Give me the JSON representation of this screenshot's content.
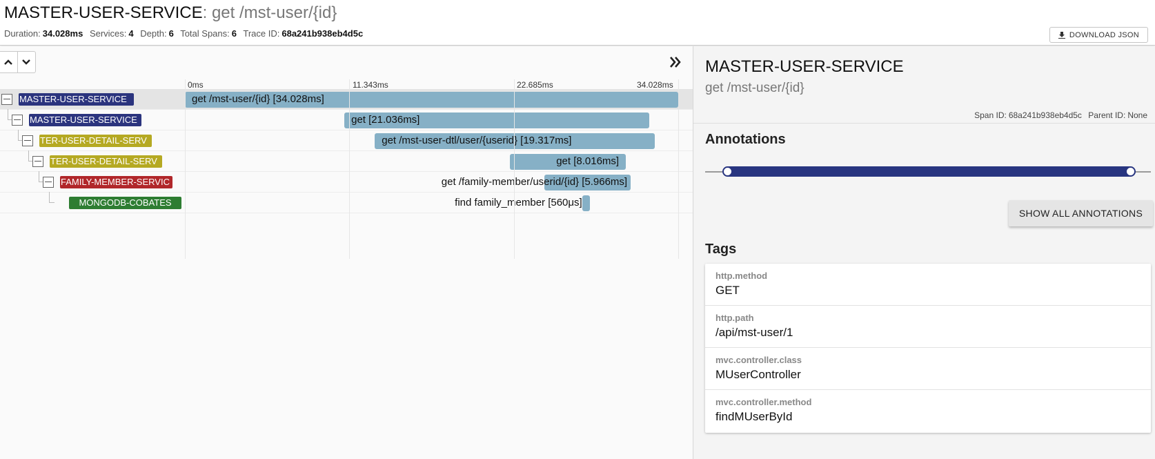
{
  "header": {
    "service": "MASTER-USER-SERVICE",
    "separator": ":",
    "span_name": " get /mst-user/{id}",
    "summary": [
      {
        "label": "Duration:",
        "value": "34.028ms"
      },
      {
        "label": "Services:",
        "value": "4"
      },
      {
        "label": "Depth:",
        "value": "6"
      },
      {
        "label": "Total Spans:",
        "value": "6"
      },
      {
        "label": "Trace ID:",
        "value": "68a241b938eb4d5c"
      }
    ],
    "download_label": "DOWNLOAD JSON"
  },
  "timeline": {
    "ticks": [
      "0ms",
      "11.343ms",
      "22.685ms",
      "34.028ms"
    ],
    "total_ms": 34.028,
    "spans": [
      {
        "service": "MASTER-USER-SERVICE",
        "service_display": "MASTER-USER-SERVICE",
        "depth": 0,
        "color": "#2b347e",
        "text_color": "#ffffff",
        "name": "get /mst-user/{id} [34.028ms]",
        "start_ms": 0.0,
        "duration_ms": 34.028,
        "selected": true
      },
      {
        "service": "MASTER-USER-SERVICE",
        "service_display": "MASTER-USER-SERVICE",
        "depth": 1,
        "color": "#2b347e",
        "text_color": "#ffffff",
        "name": "get [21.036ms]",
        "start_ms": 11.0,
        "duration_ms": 21.036,
        "selected": false
      },
      {
        "service": "MASTER-USER-DETAIL-SERVICE",
        "service_display": "TER-USER-DETAIL-SERV",
        "depth": 2,
        "color": "#b5a922",
        "text_color": "#ffffff",
        "name": "get /mst-user-dtl/user/{userid} [19.317ms]",
        "start_ms": 13.1,
        "duration_ms": 19.317,
        "selected": false
      },
      {
        "service": "MASTER-USER-DETAIL-SERVICE",
        "service_display": "TER-USER-DETAIL-SERV",
        "depth": 3,
        "color": "#b5a922",
        "text_color": "#ffffff",
        "name": "get [8.016ms]",
        "start_ms": 22.4,
        "duration_ms": 8.016,
        "selected": false
      },
      {
        "service": "FAMILY-MEMBER-SERVICE",
        "service_display": "FAMILY-MEMBER-SERVIC",
        "depth": 4,
        "color": "#b1272a",
        "text_color": "#ffffff",
        "name": "get /family-member/userid/{id} [5.966ms]",
        "start_ms": 24.8,
        "duration_ms": 5.966,
        "selected": false
      },
      {
        "service": "MONGODB-COBATES",
        "service_display": "MONGODB-COBATES",
        "depth": 5,
        "color": "#2e7d32",
        "text_color": "#ffffff",
        "name": "find family_member [560μs]",
        "start_ms": 27.4,
        "duration_ms": 0.56,
        "selected": false
      }
    ]
  },
  "detail": {
    "service": "MASTER-USER-SERVICE",
    "span_name": "get /mst-user/{id}",
    "span_id_label": "Span ID:",
    "span_id": "68a241b938eb4d5c",
    "parent_id_label": "Parent ID:",
    "parent_id": "None",
    "annotations_title": "Annotations",
    "show_all_label": "SHOW ALL ANNOTATIONS",
    "tags_title": "Tags",
    "tags": [
      {
        "key": "http.method",
        "value": "GET"
      },
      {
        "key": "http.path",
        "value": "/api/mst-user/1"
      },
      {
        "key": "mvc.controller.class",
        "value": "MUserController"
      },
      {
        "key": "mvc.controller.method",
        "value": "findMUserById"
      }
    ]
  },
  "icons": {
    "download": "download-icon",
    "up": "chevron-up-icon",
    "down": "chevron-down-icon",
    "expand": "double-chevron-right-icon",
    "collapse": "collapse-box-icon"
  }
}
